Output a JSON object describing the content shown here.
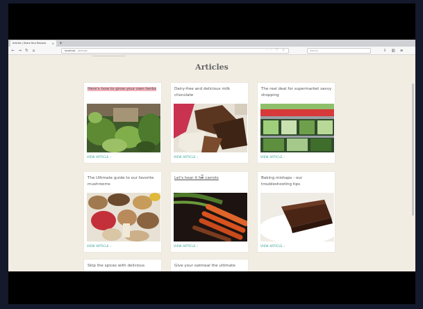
{
  "browser": {
    "tab_title": "Articles | Share Your Recipes",
    "tab_close": "×",
    "new_tab": "+",
    "url": "localhost",
    "url_path": "/articles",
    "url_tools": "··· ♡ ☆",
    "search_placeholder": "Search",
    "nav_back": "←",
    "nav_forward": "→",
    "nav_reload": "↻",
    "nav_home": "⌂",
    "right_tools": [
      "⇩",
      "▥",
      "≡"
    ]
  },
  "page": {
    "heading": "Articles",
    "cards": [
      {
        "title": "Here's how to grow your own herbs",
        "link": "VIEW ARTICLE ›",
        "image": "herbs-photo"
      },
      {
        "title": "Dairy-free and delicious milk chocolate",
        "link": "VIEW ARTICLE ›",
        "image": "chocolate-photo"
      },
      {
        "title": "The real deal for supermarket savvy shopping",
        "link": "VIEW ARTICLE ›",
        "image": "supermarket-photo"
      },
      {
        "title": "The Ultimate guide to our favorite mushrooms",
        "link": "VIEW ARTICLE ›",
        "image": "mushrooms-photo"
      },
      {
        "title": "Let's hear it for carrots",
        "link": "VIEW ARTICLE ›",
        "image": "carrots-photo"
      },
      {
        "title": "Baking mishaps - our troubleshooting tips",
        "link": "VIEW ARTICLE ›",
        "image": "brownie-photo"
      },
      {
        "title": "Skip the spices with delicious",
        "link": "",
        "image": ""
      },
      {
        "title": "Give your oatmeal the ultimate",
        "link": "",
        "image": ""
      }
    ]
  },
  "colors": {
    "page_bg": "#f1ede3",
    "link": "#2a9d8f",
    "highlight": "#f3b4bd",
    "letterbox": "#000000"
  }
}
